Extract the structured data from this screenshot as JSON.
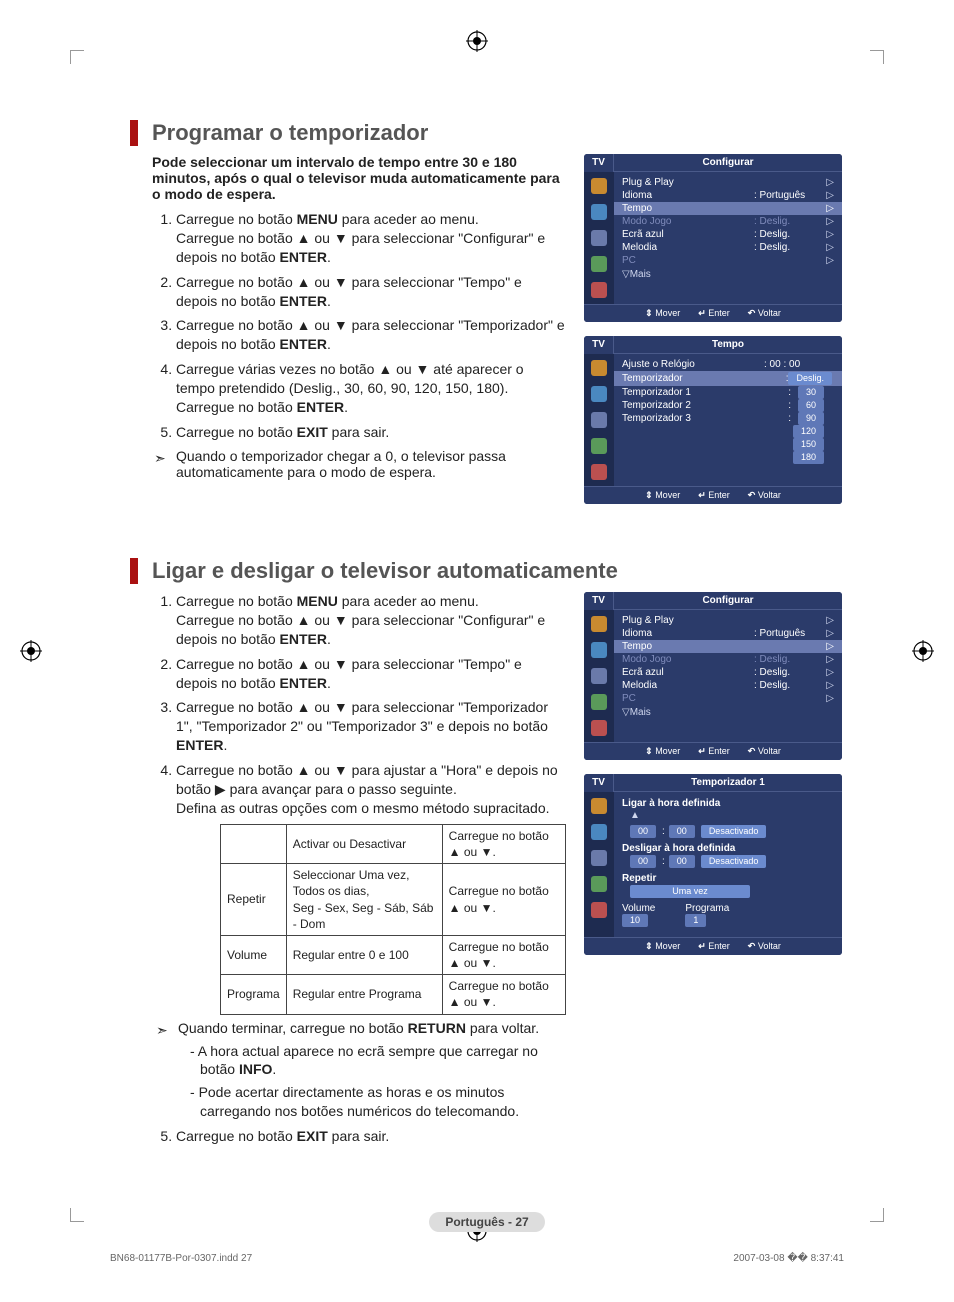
{
  "section1": {
    "title": "Programar o temporizador",
    "intro": "Pode seleccionar um intervalo de tempo entre 30 e 180 minutos, após o qual o televisor muda automaticamente para o modo de espera.",
    "steps": {
      "s1a": "Carregue no botão ",
      "s1b": "MENU",
      "s1c": " para aceder ao menu.",
      "s1d": "Carregue no botão ▲ ou ▼ para seleccionar \"Configurar\" e depois no botão ",
      "s1e": "ENTER",
      "s1f": ".",
      "s2a": "Carregue no botão ▲ ou ▼ para seleccionar \"Tempo\" e depois no botão ",
      "s2b": "ENTER",
      "s2c": ".",
      "s3a": "Carregue no botão ▲ ou ▼ para seleccionar \"Temporizador\" e depois no botão ",
      "s3b": "ENTER",
      "s3c": ".",
      "s4a": "Carregue várias vezes no botão ▲ ou ▼ até aparecer o tempo pretendido (Deslig., 30, 60, 90, 120, 150, 180). Carregue no botão ",
      "s4b": "ENTER",
      "s4c": ".",
      "s5a": "Carregue no botão ",
      "s5b": "EXIT",
      "s5c": " para sair."
    },
    "note": "Quando o temporizador chegar a 0, o televisor passa automaticamente para o modo de espera."
  },
  "section2": {
    "title": "Ligar e desligar o televisor automaticamente",
    "steps": {
      "s1a": "Carregue no botão ",
      "s1b": "MENU",
      "s1c": " para aceder ao menu.",
      "s1d": "Carregue no botão ▲ ou ▼ para seleccionar \"Configurar\" e depois no botão ",
      "s1e": "ENTER",
      "s1f": ".",
      "s2a": "Carregue no botão ▲ ou ▼ para seleccionar \"Tempo\" e depois no botão ",
      "s2b": "ENTER",
      "s2c": ".",
      "s3a": "Carregue no botão ▲ ou ▼ para seleccionar \"Temporizador 1\", \"Temporizador 2\" ou \"Temporizador 3\" e depois no botão ",
      "s3b": "ENTER",
      "s3c": ".",
      "s4a": "Carregue no botão ▲ ou ▼ para ajustar a \"Hora\" e depois no botão ▶ para avançar para o passo seguinte.",
      "s4b": "Defina as outras opções com o mesmo método supracitado.",
      "s5a": "Carregue no botão ",
      "s5b": "EXIT",
      "s5c": " para sair."
    },
    "table": {
      "r1c1": "",
      "r1c2": "Activar ou Desactivar",
      "r1c3": "Carregue no botão ▲ ou ▼.",
      "r2c1": "Repetir",
      "r2c2": "Seleccionar Uma vez, Todos os dias,\nSeg - Sex, Seg - Sáb, Sáb - Dom",
      "r2c3": "Carregue no botão ▲ ou ▼.",
      "r3c1": "Volume",
      "r3c2": "Regular entre 0 e 100",
      "r3c3": "Carregue no botão ▲ ou ▼.",
      "r4c1": "Programa",
      "r4c2": "Regular entre Programa",
      "r4c3": "Carregue no botão ▲ ou ▼."
    },
    "note1a": "Quando terminar, carregue no botão ",
    "note1b": "RETURN",
    "note1c": " para voltar.",
    "dash1a": "A hora actual aparece no ecrã sempre que carregar no botão ",
    "dash1b": "INFO",
    "dash1c": ".",
    "dash2": "Pode acertar directamente as horas e os minutos carregando nos botões numéricos do telecomando."
  },
  "osd_common": {
    "tv": "TV",
    "foot_move": "Mover",
    "foot_enter": "Enter",
    "foot_return": "Voltar",
    "more": "▽Mais"
  },
  "osd1": {
    "title": "Configurar",
    "r1": "Plug & Play",
    "r2": "Idioma",
    "r2v": ": Português",
    "r3": "Tempo",
    "r4": "Modo Jogo",
    "r4v": ": Deslig.",
    "r5": "Ecrã azul",
    "r5v": ": Deslig.",
    "r6": "Melodia",
    "r6v": ": Deslig.",
    "r7": "PC"
  },
  "osd2": {
    "title": "Tempo",
    "r1": "Ajuste o Relógio",
    "r1v": ": 00 : 00",
    "r2": "Temporizador",
    "r2v": "Deslig.",
    "r3": "Temporizador 1",
    "r3c": ":",
    "r4": "Temporizador 2",
    "r4c": ":",
    "r5": "Temporizador 3",
    "r5c": ":",
    "vals": [
      "30",
      "60",
      "90",
      "120",
      "150",
      "180"
    ]
  },
  "osd3": {
    "title": "Configurar",
    "r1": "Plug & Play",
    "r2": "Idioma",
    "r2v": ": Português",
    "r3": "Tempo",
    "r4": "Modo Jogo",
    "r4v": ": Deslig.",
    "r5": "Ecrã azul",
    "r5v": ": Deslig.",
    "r6": "Melodia",
    "r6v": ": Deslig.",
    "r7": "PC"
  },
  "osd4": {
    "title": "Temporizador 1",
    "on_label": "Ligar à hora definida",
    "off_label": "Desligar à hora definida",
    "hh": "00",
    "mm": "00",
    "state": "Desactivado",
    "repeat_label": "Repetir",
    "repeat_value": "Uma vez",
    "volume_label": "Volume",
    "volume_value": "10",
    "program_label": "Programa",
    "program_value": "1"
  },
  "page_label": "Português - 27",
  "footer_left": "BN68-01177B-Por-0307.indd   27",
  "footer_right": "2007-03-08   �� 8:37:41"
}
